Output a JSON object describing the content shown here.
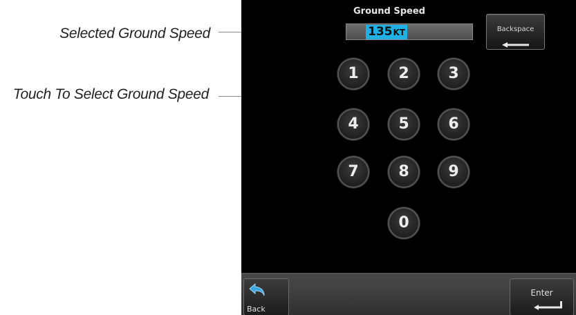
{
  "callouts": {
    "selected": "Selected Ground Speed",
    "touch": "Touch To Select Ground Speed"
  },
  "screen": {
    "title": "Ground Speed",
    "speed_value": "135",
    "speed_unit": "KT",
    "backspace_label": "Backspace",
    "keys": [
      "1",
      "2",
      "3",
      "4",
      "5",
      "6",
      "7",
      "8",
      "9",
      "0"
    ],
    "back_label": "Back",
    "enter_label": "Enter"
  },
  "colors": {
    "screen_bg": "#000000",
    "value_highlight": "#1fb1e5",
    "field_bg": "#5e5e5e"
  },
  "icons": {
    "backspace": "left-arrow-icon",
    "back": "back-arrow-icon",
    "enter": "enter-return-icon"
  }
}
